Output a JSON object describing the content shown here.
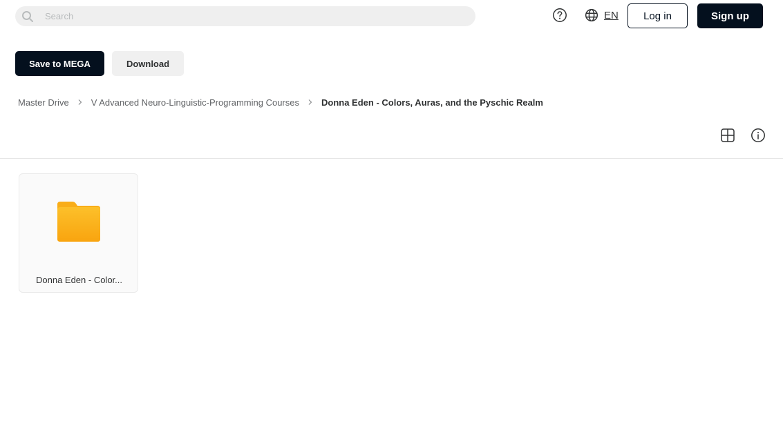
{
  "header": {
    "search_placeholder": "Search",
    "language": "EN",
    "login_label": "Log in",
    "signup_label": "Sign up"
  },
  "actions": {
    "save_label": "Save to MEGA",
    "download_label": "Download"
  },
  "breadcrumb": {
    "items": [
      "Master Drive",
      "V Advanced Neuro-Linguistic-Programming Courses"
    ],
    "current": "Donna Eden - Colors, Auras, and the Pyschic Realm"
  },
  "folders": [
    {
      "name": "Donna Eden - Color..."
    }
  ],
  "colors": {
    "primary_dark": "#04101e",
    "folder_yellow": "#fbb11c",
    "search_bg": "#efefef"
  },
  "icons": [
    "search-icon",
    "help-icon",
    "globe-icon",
    "chevron-right-icon",
    "grid-view-icon",
    "info-icon",
    "folder-icon"
  ]
}
